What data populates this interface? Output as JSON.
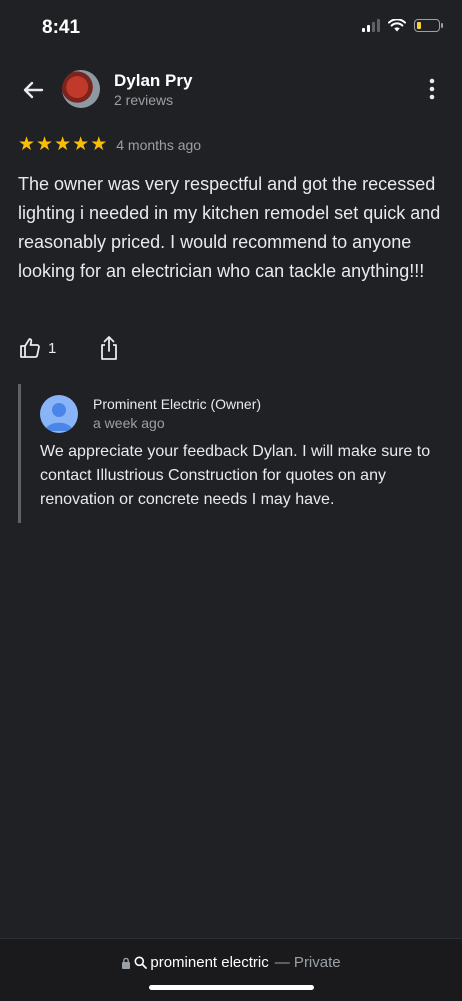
{
  "status_bar": {
    "time": "8:41"
  },
  "header": {
    "name": "Dylan Pry",
    "reviews": "2 reviews"
  },
  "review": {
    "rating": 5,
    "stars": [
      "★",
      "★",
      "★",
      "★",
      "★"
    ],
    "time_ago": "4 months ago",
    "text": "The owner was very respectful and got the recessed lighting i needed in my kitchen remodel set quick and reasonably priced. I would recommend to anyone looking for an electrician who can tackle anything!!!",
    "like_count": "1"
  },
  "owner_reply": {
    "name": "Prominent Electric (Owner)",
    "time_ago": "a week ago",
    "text": "We appreciate your feedback Dylan. I will make sure to contact Illustrious Construction for quotes on any renovation or concrete needs I may have."
  },
  "browser_bar": {
    "domain": "prominent electric",
    "private_label": "— Private"
  },
  "colors": {
    "background": "#202124",
    "star": "#fbbc04",
    "muted": "#9aa0a6",
    "reply_avatar": "#8ab4f8"
  },
  "icons": [
    "back-arrow-icon",
    "more-vert-icon",
    "thumbs-up-icon",
    "share-icon",
    "lock-icon",
    "search-icon",
    "person-icon"
  ]
}
